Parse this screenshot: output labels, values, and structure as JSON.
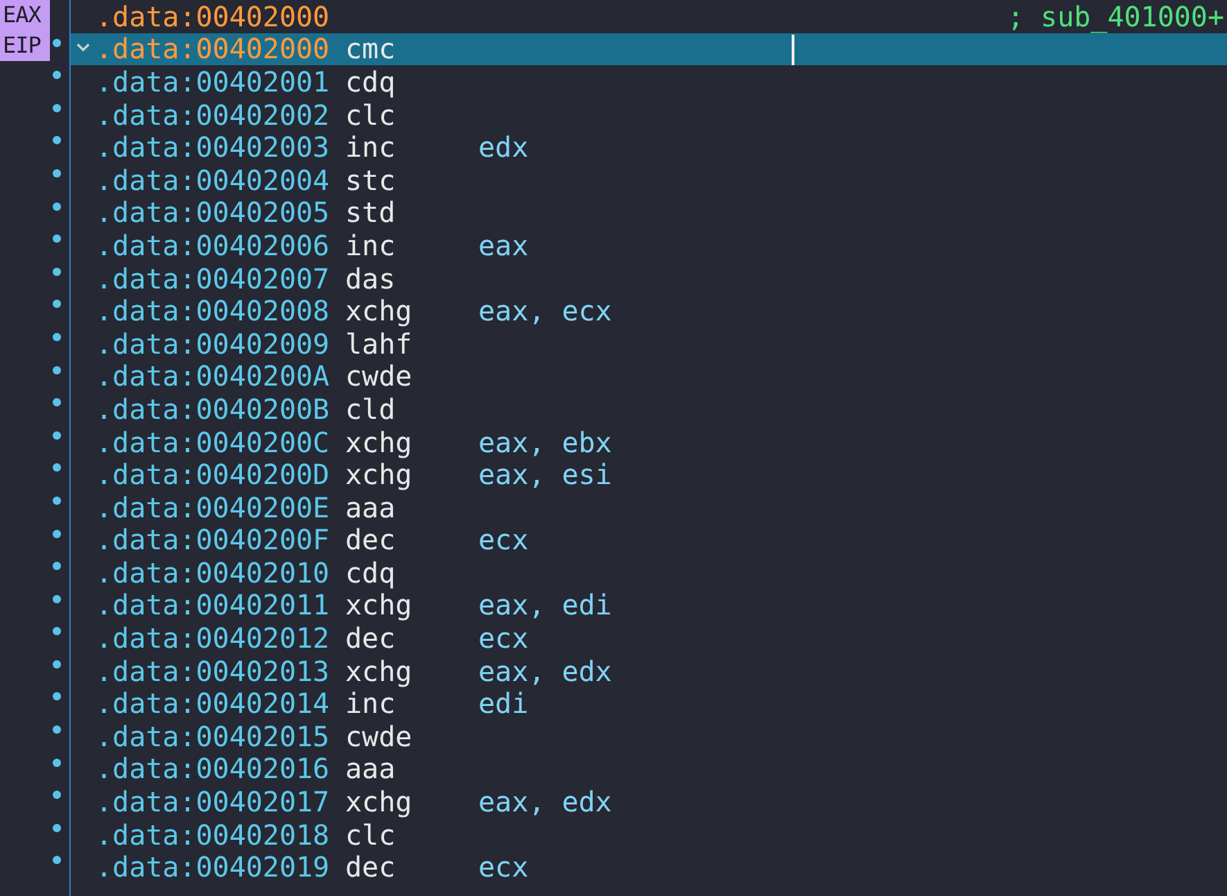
{
  "registers": [
    "EAX",
    "EIP"
  ],
  "rows": [
    {
      "kind": "label",
      "address": ".data:00402000",
      "comment": "; sub_401000+",
      "selected": false
    },
    {
      "kind": "instruction",
      "address": ".data:00402000",
      "mnemonic": "cmc",
      "selected": true
    },
    {
      "kind": "instruction",
      "address": ".data:00402001",
      "mnemonic": "cdq",
      "selected": false
    },
    {
      "kind": "instruction",
      "address": ".data:00402002",
      "mnemonic": "clc",
      "selected": false
    },
    {
      "kind": "instruction",
      "address": ".data:00402003",
      "mnemonic": "inc",
      "operands": "edx",
      "selected": false
    },
    {
      "kind": "instruction",
      "address": ".data:00402004",
      "mnemonic": "stc",
      "selected": false
    },
    {
      "kind": "instruction",
      "address": ".data:00402005",
      "mnemonic": "std",
      "selected": false
    },
    {
      "kind": "instruction",
      "address": ".data:00402006",
      "mnemonic": "inc",
      "operands": "eax",
      "selected": false
    },
    {
      "kind": "instruction",
      "address": ".data:00402007",
      "mnemonic": "das",
      "selected": false
    },
    {
      "kind": "instruction",
      "address": ".data:00402008",
      "mnemonic": "xchg",
      "operands": "eax, ecx",
      "selected": false
    },
    {
      "kind": "instruction",
      "address": ".data:00402009",
      "mnemonic": "lahf",
      "selected": false
    },
    {
      "kind": "instruction",
      "address": ".data:0040200A",
      "mnemonic": "cwde",
      "selected": false
    },
    {
      "kind": "instruction",
      "address": ".data:0040200B",
      "mnemonic": "cld",
      "selected": false
    },
    {
      "kind": "instruction",
      "address": ".data:0040200C",
      "mnemonic": "xchg",
      "operands": "eax, ebx",
      "selected": false
    },
    {
      "kind": "instruction",
      "address": ".data:0040200D",
      "mnemonic": "xchg",
      "operands": "eax, esi",
      "selected": false
    },
    {
      "kind": "instruction",
      "address": ".data:0040200E",
      "mnemonic": "aaa",
      "selected": false
    },
    {
      "kind": "instruction",
      "address": ".data:0040200F",
      "mnemonic": "dec",
      "operands": "ecx",
      "selected": false
    },
    {
      "kind": "instruction",
      "address": ".data:00402010",
      "mnemonic": "cdq",
      "selected": false
    },
    {
      "kind": "instruction",
      "address": ".data:00402011",
      "mnemonic": "xchg",
      "operands": "eax, edi",
      "selected": false
    },
    {
      "kind": "instruction",
      "address": ".data:00402012",
      "mnemonic": "dec",
      "operands": "ecx",
      "selected": false
    },
    {
      "kind": "instruction",
      "address": ".data:00402013",
      "mnemonic": "xchg",
      "operands": "eax, edx",
      "selected": false
    },
    {
      "kind": "instruction",
      "address": ".data:00402014",
      "mnemonic": "inc",
      "operands": "edi",
      "selected": false
    },
    {
      "kind": "instruction",
      "address": ".data:00402015",
      "mnemonic": "cwde",
      "selected": false
    },
    {
      "kind": "instruction",
      "address": ".data:00402016",
      "mnemonic": "aaa",
      "selected": false
    },
    {
      "kind": "instruction",
      "address": ".data:00402017",
      "mnemonic": "xchg",
      "operands": "eax, edx",
      "selected": false
    },
    {
      "kind": "instruction",
      "address": ".data:00402018",
      "mnemonic": "clc",
      "selected": false
    },
    {
      "kind": "instruction",
      "address": ".data:00402019",
      "mnemonic": "dec",
      "operands": "ecx",
      "selected": false
    }
  ]
}
